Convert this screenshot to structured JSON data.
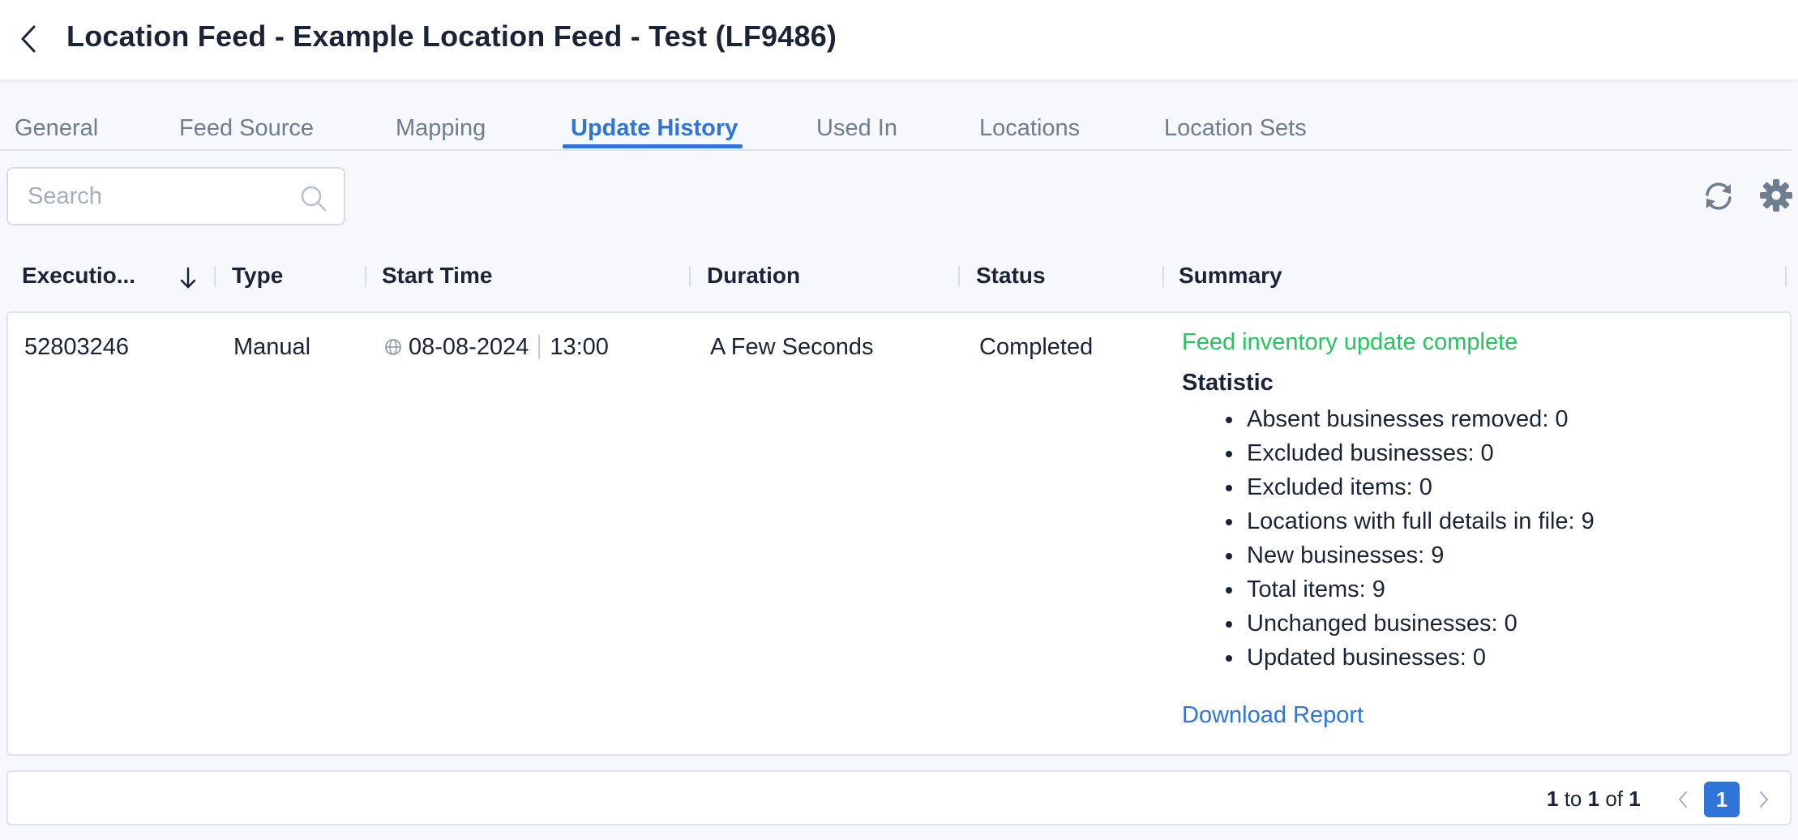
{
  "header": {
    "title": "Location Feed - Example Location Feed - Test (LF9486)",
    "back_icon": "chevron-left-icon"
  },
  "tabs": [
    {
      "label": "General",
      "active": false
    },
    {
      "label": "Feed Source",
      "active": false
    },
    {
      "label": "Mapping",
      "active": false
    },
    {
      "label": "Update History",
      "active": true
    },
    {
      "label": "Used In",
      "active": false
    },
    {
      "label": "Locations",
      "active": false
    },
    {
      "label": "Location Sets",
      "active": false
    }
  ],
  "search": {
    "placeholder": "Search",
    "value": ""
  },
  "toolbar": {
    "refresh_icon": "refresh-icon",
    "settings_icon": "gear-icon"
  },
  "table": {
    "columns": [
      "Executio...",
      "Type",
      "Start Time",
      "Duration",
      "Status",
      "Summary"
    ],
    "sort_icon": "arrow-down-icon",
    "rows": [
      {
        "execution": "52803246",
        "type": "Manual",
        "start_date": "08-08-2024",
        "start_time": "13:00",
        "duration": "A Few Seconds",
        "status": "Completed",
        "summary": {
          "message": "Feed inventory update complete",
          "statistic_title": "Statistic",
          "statistics": [
            "Absent businesses removed: 0",
            "Excluded businesses: 0",
            "Excluded items: 0",
            "Locations with full details in file: 9",
            "New businesses: 9",
            "Total items: 9",
            "Unchanged businesses: 0",
            "Updated businesses: 0"
          ],
          "download_label": "Download Report"
        }
      }
    ]
  },
  "pagination": {
    "from": "1",
    "to_word": "to",
    "to": "1",
    "of_word": "of",
    "total": "1",
    "current_page": "1"
  },
  "colors": {
    "accent": "#2f74d9",
    "success": "#22c55e",
    "text": "#1a2436",
    "muted": "#6f7d91"
  }
}
